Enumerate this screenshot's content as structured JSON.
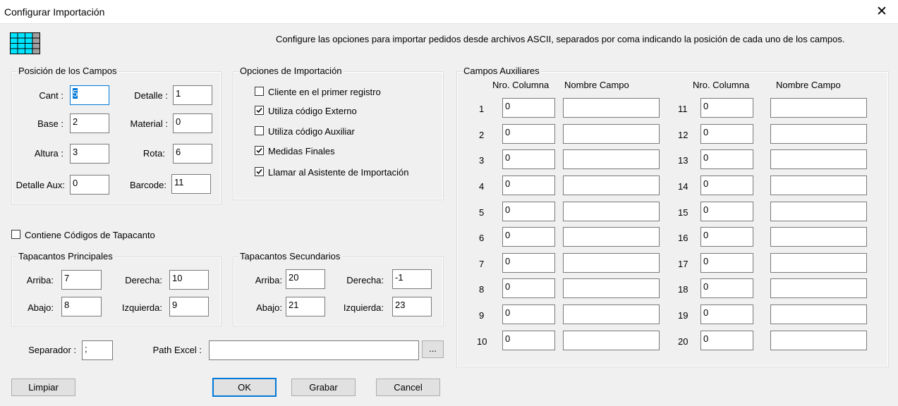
{
  "window": {
    "title": "Configurar Importación",
    "close_glyph": "✕"
  },
  "description": "Configure las opciones para importar pedidos desde archivos ASCII, separados por coma indicando la posición de cada uno de los campos.",
  "icon": "grid-table-icon",
  "colors": {
    "accent": "#0078d7",
    "icon_cyan": "#00e5ff",
    "icon_gray": "#a0a0a0"
  },
  "posicion": {
    "title": "Posición de los Campos",
    "cant_label": "Cant :",
    "cant_value": "5",
    "detalle_label": "Detalle :",
    "detalle_value": "1",
    "base_label": "Base :",
    "base_value": "2",
    "material_label": "Material :",
    "material_value": "0",
    "altura_label": "Altura :",
    "altura_value": "3",
    "rota_label": "Rota:",
    "rota_value": "6",
    "detalle_aux_label": "Detalle Aux:",
    "detalle_aux_value": "0",
    "barcode_label": "Barcode:",
    "barcode_value": "11"
  },
  "opciones": {
    "title": "Opciones de Importación",
    "items": [
      {
        "label": "Cliente en el primer registro",
        "checked": false
      },
      {
        "label": "Utiliza código Externo",
        "checked": true
      },
      {
        "label": "Utiliza código Auxiliar",
        "checked": false
      },
      {
        "label": "Medidas Finales",
        "checked": true
      },
      {
        "label": "Llamar al Asistente de Importación",
        "checked": true
      }
    ]
  },
  "contiene": {
    "label": "Contiene Códigos de Tapacanto",
    "checked": false
  },
  "tap_principales": {
    "title": "Tapacantos Principales",
    "arriba_label": "Arriba:",
    "arriba_value": "7",
    "derecha_label": "Derecha:",
    "derecha_value": "10",
    "abajo_label": "Abajo:",
    "abajo_value": "8",
    "izquierda_label": "Izquierda:",
    "izquierda_value": "9"
  },
  "tap_secundarios": {
    "title": "Tapacantos Secundarios",
    "arriba_label": "Arriba:",
    "arriba_value": "20",
    "derecha_label": "Derecha:",
    "derecha_value": "-1",
    "abajo_label": "Abajo:",
    "abajo_value": "21",
    "izquierda_label": "Izquierda:",
    "izquierda_value": "23"
  },
  "separador": {
    "label": "Separador :",
    "value": ";"
  },
  "path_excel": {
    "label": "Path Excel :",
    "value": "",
    "browse_label": "..."
  },
  "auxiliares": {
    "title": "Campos Auxiliares",
    "col_header": "Nro. Columna",
    "name_header": "Nombre Campo",
    "rows_left": [
      {
        "num": "1",
        "col": "0",
        "name": ""
      },
      {
        "num": "2",
        "col": "0",
        "name": ""
      },
      {
        "num": "3",
        "col": "0",
        "name": ""
      },
      {
        "num": "4",
        "col": "0",
        "name": ""
      },
      {
        "num": "5",
        "col": "0",
        "name": ""
      },
      {
        "num": "6",
        "col": "0",
        "name": ""
      },
      {
        "num": "7",
        "col": "0",
        "name": ""
      },
      {
        "num": "8",
        "col": "0",
        "name": ""
      },
      {
        "num": "9",
        "col": "0",
        "name": ""
      },
      {
        "num": "10",
        "col": "0",
        "name": ""
      }
    ],
    "rows_right": [
      {
        "num": "11",
        "col": "0",
        "name": ""
      },
      {
        "num": "12",
        "col": "0",
        "name": ""
      },
      {
        "num": "13",
        "col": "0",
        "name": ""
      },
      {
        "num": "14",
        "col": "0",
        "name": ""
      },
      {
        "num": "15",
        "col": "0",
        "name": ""
      },
      {
        "num": "16",
        "col": "0",
        "name": ""
      },
      {
        "num": "17",
        "col": "0",
        "name": ""
      },
      {
        "num": "18",
        "col": "0",
        "name": ""
      },
      {
        "num": "19",
        "col": "0",
        "name": ""
      },
      {
        "num": "20",
        "col": "0",
        "name": ""
      }
    ]
  },
  "buttons": {
    "limpiar": "Limpiar",
    "ok": "OK",
    "grabar": "Grabar",
    "cancel": "Cancel"
  }
}
